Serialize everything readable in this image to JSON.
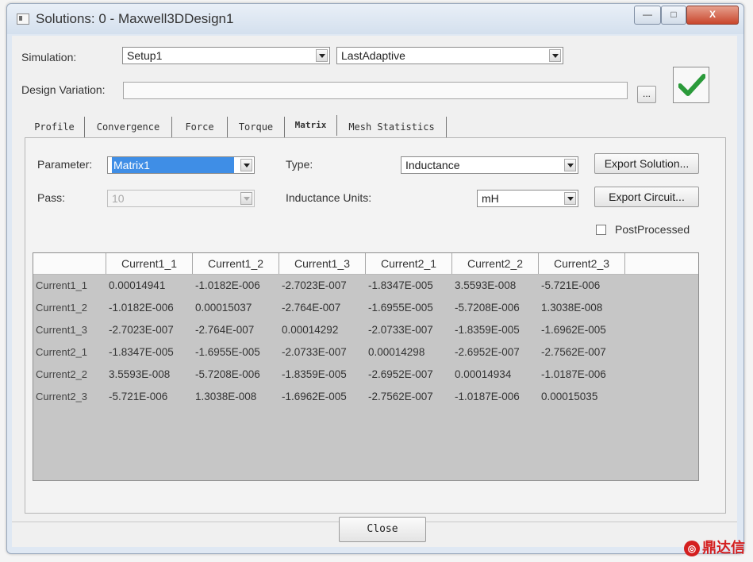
{
  "window": {
    "title": "Solutions: 0 - Maxwell3DDesign1",
    "controls": {
      "minimize": "—",
      "maximize": "□",
      "close": "X"
    }
  },
  "simulation": {
    "label": "Simulation:",
    "setup_value": "Setup1",
    "solution_value": "LastAdaptive"
  },
  "design_variation": {
    "label": "Design Variation:",
    "value": "",
    "browse_label": "..."
  },
  "tabs": [
    {
      "label": "Profile"
    },
    {
      "label": "Convergence"
    },
    {
      "label": "Force"
    },
    {
      "label": "Torque"
    },
    {
      "label": "Matrix"
    },
    {
      "label": "Mesh Statistics"
    }
  ],
  "active_tab": "Matrix",
  "matrix": {
    "parameter_label": "Parameter:",
    "parameter_value": "Matrix1",
    "pass_label": "Pass:",
    "pass_value": "10",
    "type_label": "Type:",
    "type_value": "Inductance",
    "units_label": "Inductance Units:",
    "units_value": "mH",
    "export_solution_label": "Export Solution...",
    "export_circuit_label": "Export Circuit...",
    "postprocessed_label": "PostProcessed",
    "postprocessed_checked": false,
    "columns": [
      "Current1_1",
      "Current1_2",
      "Current1_3",
      "Current2_1",
      "Current2_2",
      "Current2_3"
    ],
    "rows": [
      {
        "name": "Current1_1",
        "values": [
          "0.00014941",
          "-1.0182E-006",
          "-2.7023E-007",
          "-1.8347E-005",
          "3.5593E-008",
          "-5.721E-006"
        ]
      },
      {
        "name": "Current1_2",
        "values": [
          "-1.0182E-006",
          "0.00015037",
          "-2.764E-007",
          "-1.6955E-005",
          "-5.7208E-006",
          "1.3038E-008"
        ]
      },
      {
        "name": "Current1_3",
        "values": [
          "-2.7023E-007",
          "-2.764E-007",
          "0.00014292",
          "-2.0733E-007",
          "-1.8359E-005",
          "-1.6962E-005"
        ]
      },
      {
        "name": "Current2_1",
        "values": [
          "-1.8347E-005",
          "-1.6955E-005",
          "-2.0733E-007",
          "0.00014298",
          "-2.6952E-007",
          "-2.7562E-007"
        ]
      },
      {
        "name": "Current2_2",
        "values": [
          "3.5593E-008",
          "-5.7208E-006",
          "-1.8359E-005",
          "-2.6952E-007",
          "0.00014934",
          "-1.0187E-006"
        ]
      },
      {
        "name": "Current2_3",
        "values": [
          "-5.721E-006",
          "1.3038E-008",
          "-1.6962E-005",
          "-2.7562E-007",
          "-1.0187E-006",
          "0.00015035"
        ]
      }
    ]
  },
  "close_label": "Close",
  "watermark": "鼎达信",
  "colors": {
    "accent_selection": "#3f8ee6",
    "check_green": "#2a9a3a",
    "grid_background": "#c6c6c6"
  }
}
